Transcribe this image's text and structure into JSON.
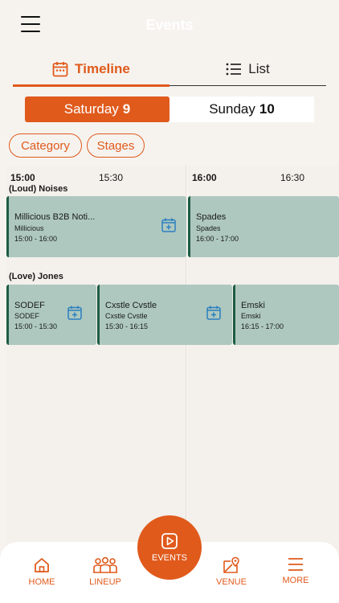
{
  "header": {
    "title": "Events"
  },
  "view_tabs": {
    "timeline": "Timeline",
    "list": "List"
  },
  "days": [
    {
      "weekday": "Saturday",
      "day": "9"
    },
    {
      "weekday": "Sunday",
      "day": "10"
    }
  ],
  "filters": {
    "category": "Category",
    "stages": "Stages"
  },
  "time_ticks": [
    "15:00",
    "15:30",
    "16:00",
    "16:30"
  ],
  "stages": [
    {
      "name": "(Loud) Noises",
      "events": [
        {
          "title": "Millicious B2B Noti...",
          "artist": "Millicious",
          "time": "15:00 - 16:00"
        },
        {
          "title": "Spades",
          "artist": "Spades",
          "time": "16:00 - 17:00"
        }
      ]
    },
    {
      "name": "(Love) Jones",
      "events": [
        {
          "title": "SODEF",
          "artist": "SODEF",
          "time": "15:00 - 15:30"
        },
        {
          "title": "Cxstle Cvstle",
          "artist": "Cxstle Cvstle",
          "time": "15:30 - 16:15"
        },
        {
          "title": "Emski",
          "artist": "Emski",
          "time": "16:15 - 17:00"
        }
      ]
    }
  ],
  "nav": {
    "home": "HOME",
    "lineup": "LINEUP",
    "events": "EVENTS",
    "venue": "VENUE",
    "more": "MORE"
  },
  "colors": {
    "accent": "#e05a1c",
    "event_bg": "#aec8bf",
    "event_border": "#1d5c44",
    "calendar_icon": "#2a7fc1"
  }
}
